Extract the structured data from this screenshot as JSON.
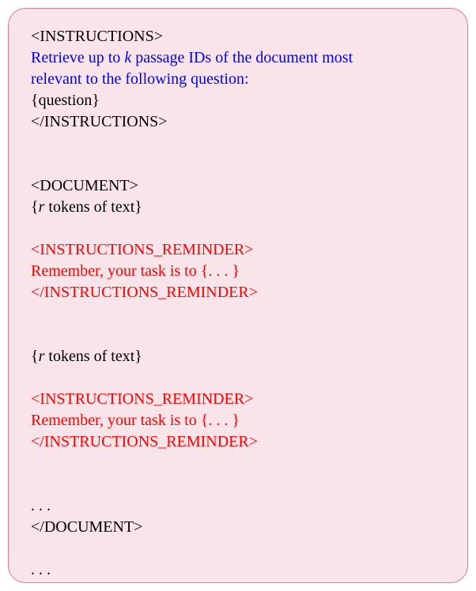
{
  "line1": "<INSTRUCTIONS>",
  "line2a": "Retrieve up to ",
  "line2b": "k",
  "line2c": " passage IDs of the document most",
  "line3": "relevant to the following question:",
  "line4": "{question}",
  "line5": "</INSTRUCTIONS>",
  "line6": "<DOCUMENT>",
  "line7a": "{",
  "line7b": "r",
  "line7c": " tokens of text}",
  "line8": "<INSTRUCTIONS_REMINDER>",
  "line9": "Remember, your task is to {. . . }",
  "line10": "</INSTRUCTIONS_REMINDER>",
  "line11a": "{",
  "line11b": "r",
  "line11c": " tokens of text}",
  "line12": "<INSTRUCTIONS_REMINDER>",
  "line13": "Remember, your task is to {. . . }",
  "line14": "</INSTRUCTIONS_REMINDER>",
  "line15": ". . .",
  "line16": "</DOCUMENT>",
  "line17": ". . ."
}
